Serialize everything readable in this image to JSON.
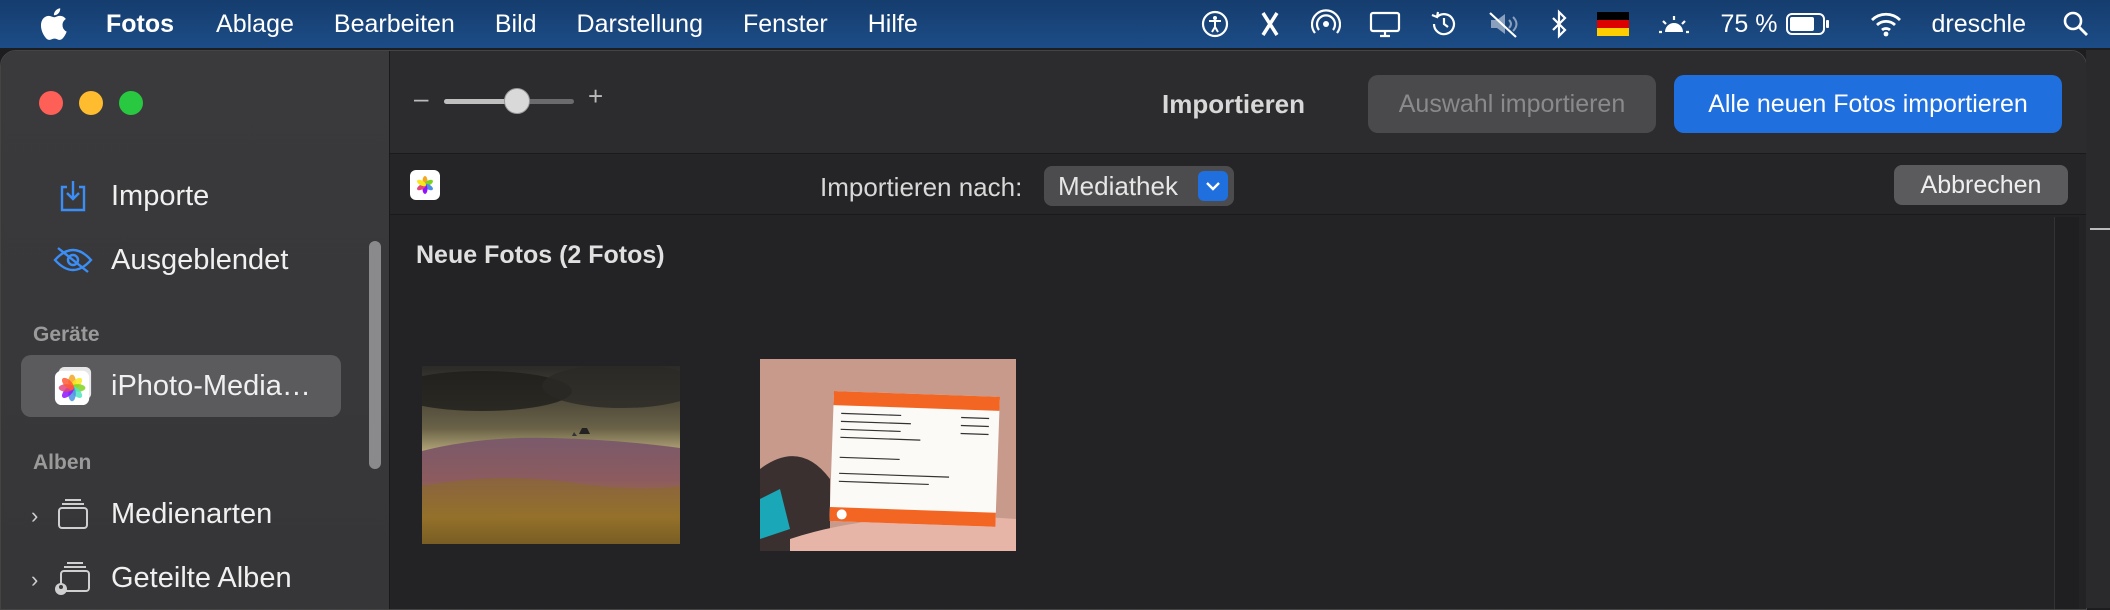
{
  "menubar": {
    "app_name": "Fotos",
    "items": [
      "Ablage",
      "Bearbeiten",
      "Bild",
      "Darstellung",
      "Fenster",
      "Hilfe"
    ],
    "battery_percent": "75 %",
    "user": "dreschle",
    "status_icons": [
      "accessibility-icon",
      "tools-icon",
      "airdrop-icon",
      "display-icon",
      "time-machine-icon",
      "mute-icon",
      "bluetooth-icon",
      "german-flag-icon",
      "brightness-icon",
      "battery-icon",
      "wifi-icon",
      "search-icon"
    ]
  },
  "sidebar": {
    "items": [
      {
        "label": "Importe",
        "icon": "import-icon"
      },
      {
        "label": "Ausgeblendet",
        "icon": "hidden-eye-icon"
      }
    ],
    "devices_header": "Geräte",
    "device": {
      "label": "iPhoto-Media…",
      "icon": "photos-library-icon"
    },
    "albums_header": "Alben",
    "albums": [
      {
        "label": "Medienarten",
        "icon": "stack-icon"
      },
      {
        "label": "Geteilte Alben",
        "icon": "shared-stack-icon"
      }
    ]
  },
  "toolbar": {
    "zoom_level": 0.55,
    "title": "Importieren",
    "import_selection_label": "Auswahl importieren",
    "import_all_label": "Alle neuen Fotos importieren"
  },
  "import_bar": {
    "label": "Importieren nach:",
    "destination": "Mediathek",
    "cancel_label": "Abbrechen"
  },
  "content": {
    "section_title": "Neue Fotos (2 Fotos)",
    "photos": [
      "landscape-photo",
      "train-ticket-photo"
    ]
  },
  "colors": {
    "menubar_bg": "#1c4c86",
    "accent": "#1f6fde",
    "sidebar_bg": "#3a3a3c",
    "window_bg": "#232325"
  }
}
